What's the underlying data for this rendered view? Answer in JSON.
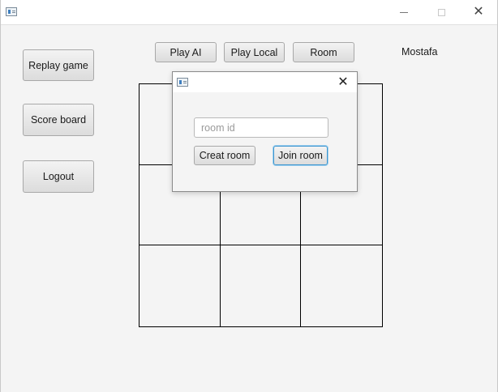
{
  "window": {
    "title": ""
  },
  "sidebar": {
    "replay_label": "Replay game",
    "score_label": "Score board",
    "logout_label": "Logout"
  },
  "mode_bar": {
    "play_ai_label": "Play AI",
    "play_local_label": "Play Local",
    "room_label": "Room"
  },
  "user": {
    "name": "Mostafa"
  },
  "board": {
    "cells": [
      "",
      "",
      "",
      "",
      "",
      "",
      "",
      "",
      ""
    ]
  },
  "room_dialog": {
    "title": "",
    "room_id_placeholder": "room id",
    "room_id_value": "",
    "create_label": "Creat room",
    "join_label": "Join room",
    "focused_button": "join"
  },
  "icons": {
    "app": "app-window-icon",
    "minimize": "minimize-icon",
    "maximize": "maximize-icon",
    "close": "close-icon"
  },
  "colors": {
    "focus_ring": "#3c95cf",
    "window_bg": "#f4f4f4",
    "grid_line": "#000000"
  }
}
